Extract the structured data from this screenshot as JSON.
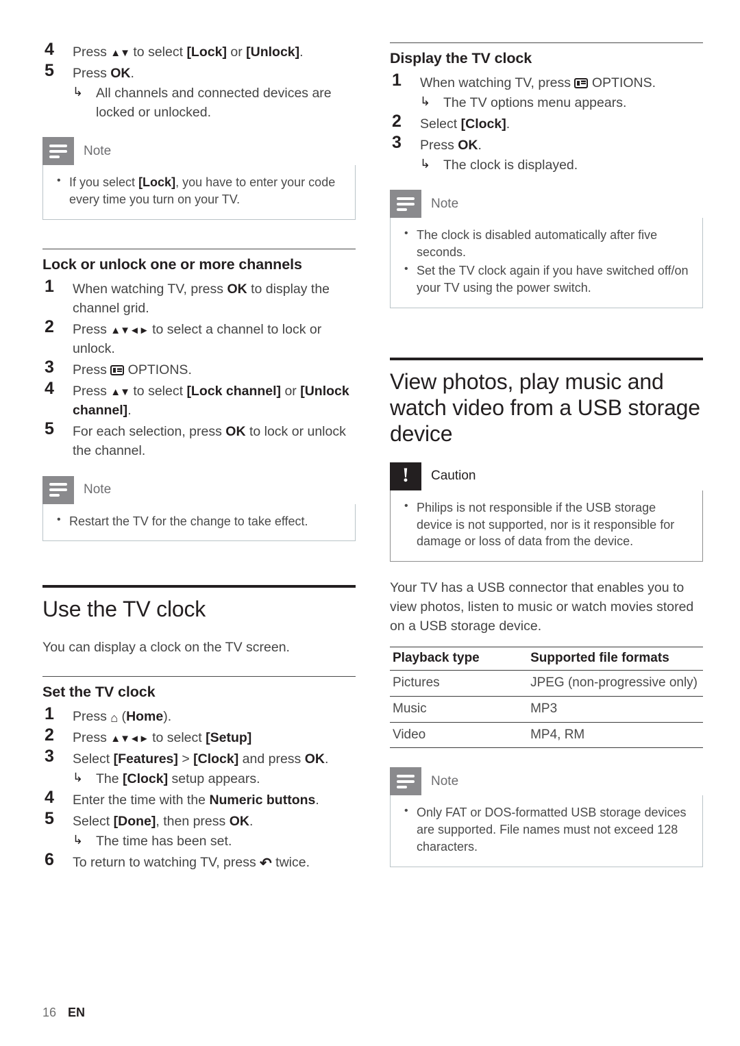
{
  "page": {
    "number": "16",
    "language": "EN"
  },
  "left_column": {
    "continued_steps": [
      {
        "num": "4",
        "html": "Press <span class=\"nav-keys\">▲▼</span> to select <b>[Lock]</b> or <b>[Unlock]</b>."
      },
      {
        "num": "5",
        "html": "Press <b>OK</b>.",
        "result": "All channels and connected devices are locked or unlocked."
      }
    ],
    "note_lock": {
      "title": "Note",
      "bullets": [
        "If you select <b>[Lock]</b>, you have to enter your code every time you turn on your TV."
      ]
    },
    "section_lock_channels": {
      "heading": "Lock or unlock one or more channels",
      "steps": [
        {
          "num": "1",
          "html": "When watching TV, press <b>OK</b> to display the channel grid."
        },
        {
          "num": "2",
          "html": "Press <span class=\"nav-keys\">▲▼◄►</span> to select a channel to lock or unlock."
        },
        {
          "num": "3",
          "html": "Press <span class=\"ico ico-options\"></span> OPTIONS."
        },
        {
          "num": "4",
          "html": "Press <span class=\"nav-keys\">▲▼</span> to select <b>[Lock channel]</b> or <b>[Unlock channel]</b>."
        },
        {
          "num": "5",
          "html": "For each selection, press <b>OK</b> to lock or unlock the channel."
        }
      ]
    },
    "note_restart": {
      "title": "Note",
      "bullets": [
        "Restart the TV for the change to take effect."
      ]
    },
    "section_tv_clock": {
      "heading": "Use the TV clock",
      "intro": "You can display a clock on the TV screen.",
      "sub_heading": "Set the TV clock",
      "steps": [
        {
          "num": "1",
          "html": "Press <span class=\"ico ico-home\">⌂</span> (<b>Home</b>)."
        },
        {
          "num": "2",
          "html": "Press <span class=\"nav-keys\">▲▼◄►</span> to select <b>[Setup]</b>"
        },
        {
          "num": "3",
          "html": "Select <b>[Features]</b> &gt; <b>[Clock]</b> and press <b>OK</b>.",
          "result": "The <b>[Clock]</b> setup appears."
        },
        {
          "num": "4",
          "html": "Enter the time with the <b>Numeric buttons</b>."
        },
        {
          "num": "5",
          "html": "Select <b>[Done]</b>, then press <b>OK</b>.",
          "result": "The time has been set."
        },
        {
          "num": "6",
          "html": "To return to watching TV, press <span class=\"ico ico-back\">↶</span> twice."
        }
      ]
    }
  },
  "right_column": {
    "section_display_clock": {
      "heading": "Display the TV clock",
      "steps": [
        {
          "num": "1",
          "html": "When watching TV, press <span class=\"ico ico-options\"></span> OPTIONS.",
          "result": "The TV options menu appears."
        },
        {
          "num": "2",
          "html": "Select <b>[Clock]</b>."
        },
        {
          "num": "3",
          "html": "Press <b>OK</b>.",
          "result": "The clock is displayed."
        }
      ]
    },
    "note_clock": {
      "title": "Note",
      "bullets": [
        "The clock is disabled automatically after five seconds.",
        "Set the TV clock again if you have switched off/on your TV using the power switch."
      ]
    },
    "section_usb": {
      "heading": "View photos, play music and watch video from a USB storage device",
      "caution": {
        "title": "Caution",
        "bullets": [
          "Philips is not responsible if the USB storage device is not supported, nor is it responsible for damage or loss of data from the device."
        ]
      },
      "body": "Your TV has a USB connector that enables you to view photos, listen to music or watch movies stored on a USB storage device.",
      "table": {
        "headers": [
          "Playback type",
          "Supported file formats"
        ],
        "rows": [
          [
            "Pictures",
            "JPEG (non-progressive only)"
          ],
          [
            "Music",
            "MP3"
          ],
          [
            "Video",
            "MP4, RM"
          ]
        ]
      },
      "note_usb": {
        "title": "Note",
        "bullets": [
          "Only FAT or DOS-formatted USB storage devices are supported. File names must not exceed 128 characters."
        ]
      }
    }
  }
}
